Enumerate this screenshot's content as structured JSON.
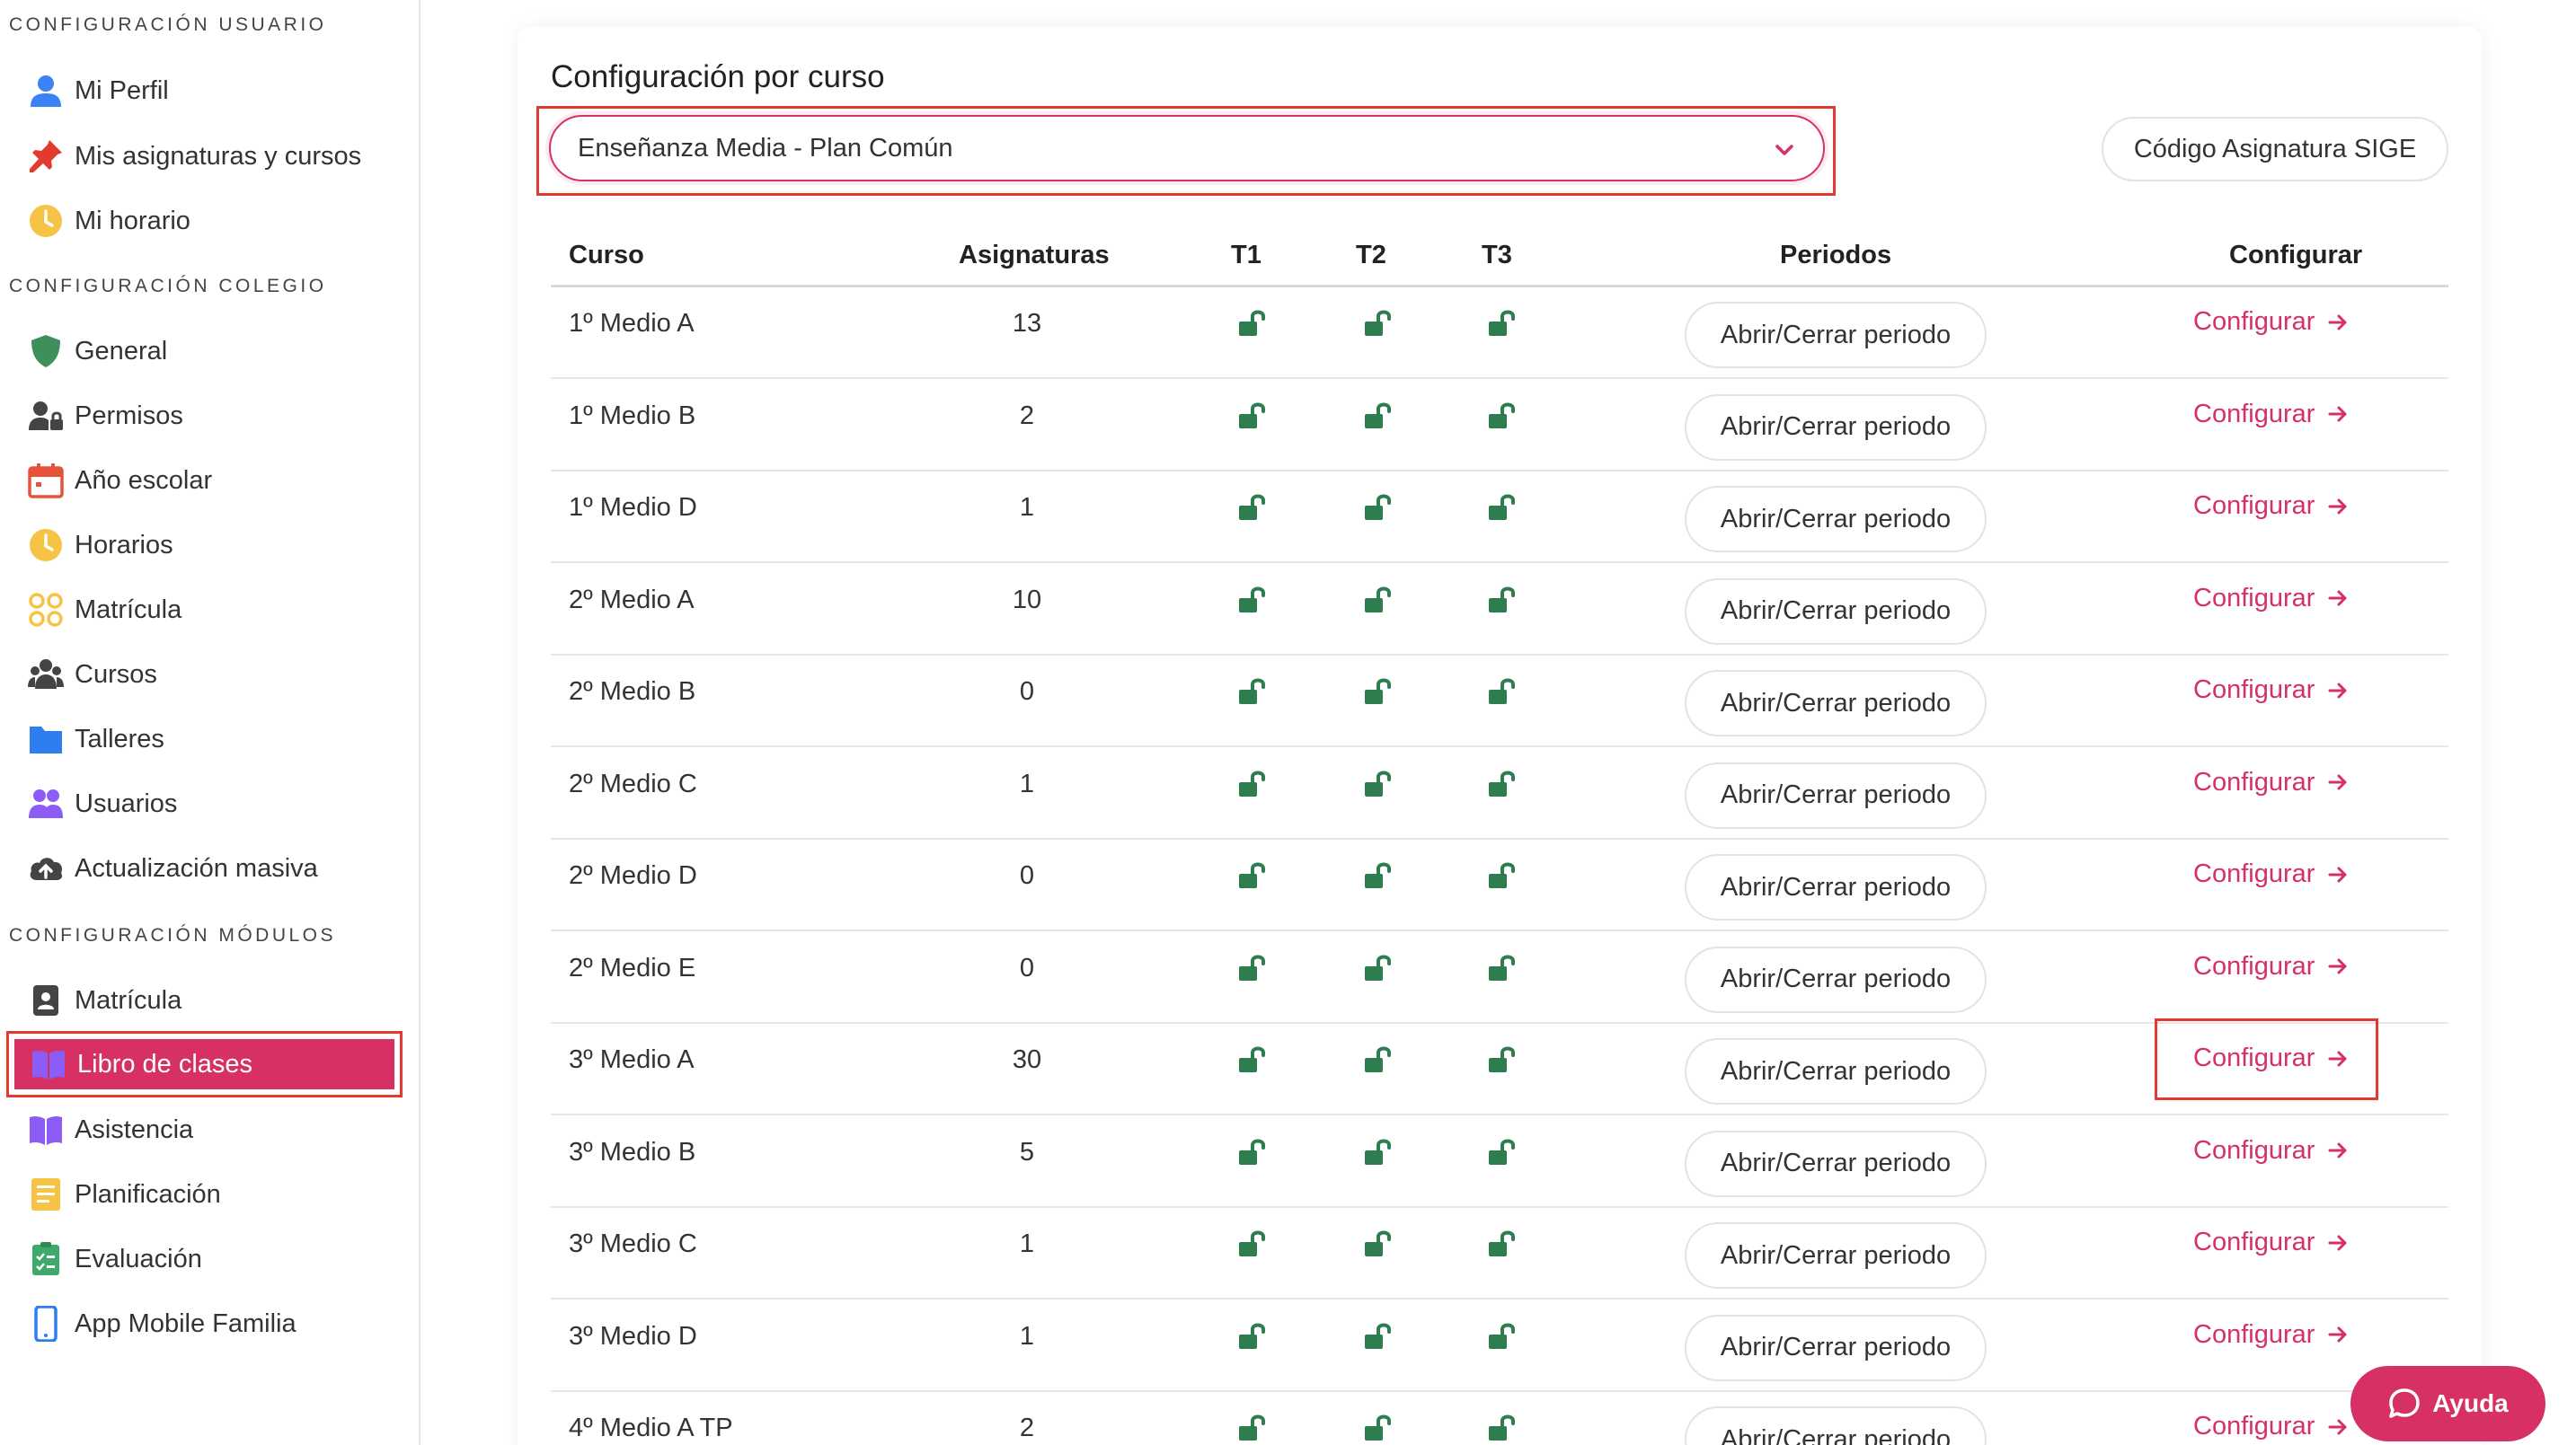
{
  "sidebar": {
    "sections": [
      {
        "title": "Configuración Usuario",
        "items": [
          {
            "label": "Mi Perfil",
            "icon": "user-icon",
            "color": "#3b82f6"
          },
          {
            "label": "Mis asignaturas y cursos",
            "icon": "pin-icon",
            "color": "#e23a2f"
          },
          {
            "label": "Mi horario",
            "icon": "clock-icon",
            "color": "#f6c344"
          }
        ]
      },
      {
        "title": "Configuración Colegio",
        "items": [
          {
            "label": "General",
            "icon": "shield-icon",
            "color": "#3f8f5a"
          },
          {
            "label": "Permisos",
            "icon": "user-lock-icon",
            "color": "#444444"
          },
          {
            "label": "Año escolar",
            "icon": "calendar-icon",
            "color": "#e5533b"
          },
          {
            "label": "Horarios",
            "icon": "clock-icon",
            "color": "#f6c344"
          },
          {
            "label": "Matrícula",
            "icon": "enrollment-icon",
            "color": "#f6c344"
          },
          {
            "label": "Cursos",
            "icon": "users-cog-icon",
            "color": "#444444"
          },
          {
            "label": "Talleres",
            "icon": "folder-icon",
            "color": "#2f7ef0"
          },
          {
            "label": "Usuarios",
            "icon": "users-icon",
            "color": "#8b5cf6"
          },
          {
            "label": "Actualización masiva",
            "icon": "cloud-upload-icon",
            "color": "#444444"
          }
        ]
      },
      {
        "title": "Configuración Módulos",
        "items": [
          {
            "label": "Matrícula",
            "icon": "id-badge-icon",
            "color": "#444444"
          },
          {
            "label": "Libro de clases",
            "icon": "book-open-icon",
            "color": "#8b5cf6",
            "active": true
          },
          {
            "label": "Asistencia",
            "icon": "book-open-icon",
            "color": "#8b5cf6"
          },
          {
            "label": "Planificación",
            "icon": "planning-icon",
            "color": "#f6c344"
          },
          {
            "label": "Evaluación",
            "icon": "checklist-icon",
            "color": "#3fa96b"
          },
          {
            "label": "App Mobile Familia",
            "icon": "mobile-icon",
            "color": "#2f7ef0"
          }
        ]
      }
    ]
  },
  "main": {
    "title": "Configuración por curso",
    "select_value": "Enseñanza Media - Plan Común",
    "sige_button": "Código Asignatura SIGE",
    "columns": [
      "Curso",
      "Asignaturas",
      "T1",
      "T2",
      "T3",
      "Periodos",
      "Configurar"
    ],
    "period_button_label": "Abrir/Cerrar periodo",
    "configure_label": "Configurar",
    "rows": [
      {
        "curso": "1º Medio A",
        "asignaturas": "13"
      },
      {
        "curso": "1º Medio B",
        "asignaturas": "2"
      },
      {
        "curso": "1º Medio D",
        "asignaturas": "1"
      },
      {
        "curso": "2º Medio A",
        "asignaturas": "10"
      },
      {
        "curso": "2º Medio B",
        "asignaturas": "0"
      },
      {
        "curso": "2º Medio C",
        "asignaturas": "1"
      },
      {
        "curso": "2º Medio D",
        "asignaturas": "0"
      },
      {
        "curso": "2º Medio E",
        "asignaturas": "0"
      },
      {
        "curso": "3º Medio A",
        "asignaturas": "30"
      },
      {
        "curso": "3º Medio B",
        "asignaturas": "5"
      },
      {
        "curso": "3º Medio C",
        "asignaturas": "1"
      },
      {
        "curso": "3º Medio D",
        "asignaturas": "1"
      },
      {
        "curso": "4º Medio A TP",
        "asignaturas": "2"
      }
    ]
  },
  "help_button": "Ayuda",
  "colors": {
    "accent": "#d63064",
    "lock": "#2e7d4f",
    "highlight": "#e23a2f"
  }
}
